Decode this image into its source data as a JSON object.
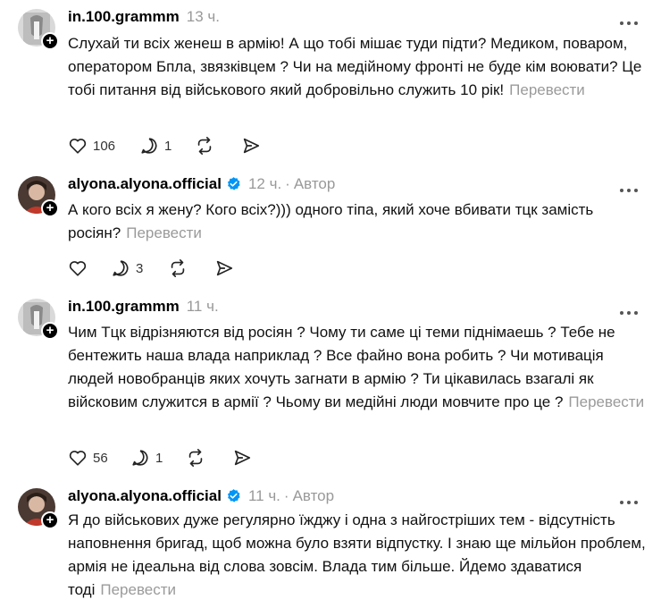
{
  "posts": [
    {
      "username": "in.100.grammm",
      "time": "13 ч.",
      "author": "",
      "text": "Слухай ти всіх женеш в армію! А що тобі мішає туди підти? Медиком, поваром, оператором Бпла, звязківцем ? Чи на медійному фронті не буде кім воювати? Це тобі питання від військового який добровільно служить 10 рік!",
      "translate": "Перевести",
      "likes": "106",
      "replies": "1"
    },
    {
      "username": "alyona.alyona.official",
      "time": "12 ч.",
      "author": "Автор",
      "text": "А кого всіх я жену? Кого всіх?))) одного тіпа, який хоче вбивати тцк замість росіян?",
      "translate": "Перевести",
      "likes": "",
      "replies": "3"
    },
    {
      "username": "in.100.grammm",
      "time": "11 ч.",
      "author": "",
      "text": "Чим Тцк відрізняются від росіян ? Чому ти саме ці теми піднімаешь ? Тебе не бентежить наша влада наприклад ? Все файно вона робить ? Чи мотивація людей новобранців яких хочуть загнати в армію ? Ти цікавилась взагалі як війсковим служится в армії ? Чьому ви медійні люди мовчите про це ?",
      "translate": "Перевести",
      "likes": "56",
      "replies": "1"
    },
    {
      "username": "alyona.alyona.official",
      "time": "11 ч.",
      "author": "Автор",
      "text": "Я до військових дуже регулярно їжджу і одна з найгостріших тем - відсутність наповнення бригад, щоб можна було взяти відпустку. І знаю ще мільйон проблем, армія не ідеальна від слова зовсім. Влада тим більше. Йдемо здаватися тоді",
      "translate": "Перевести",
      "likes": "",
      "replies": ""
    }
  ],
  "colors": {
    "verified": "#0095f6",
    "muted": "#999999",
    "text": "#111111"
  },
  "icons": [
    "heart-icon",
    "comment-icon",
    "repost-icon",
    "share-icon",
    "more-icon",
    "verified-icon",
    "follow-plus-icon"
  ]
}
